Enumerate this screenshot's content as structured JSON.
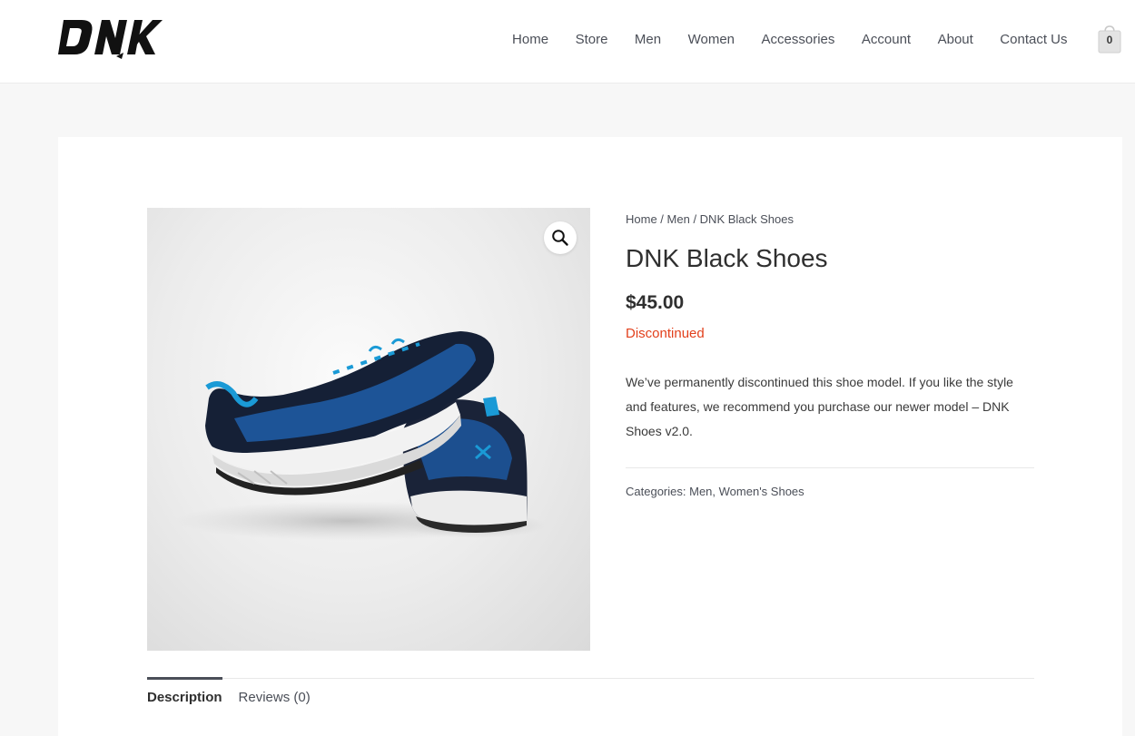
{
  "header": {
    "logo_alt": "DNK",
    "nav": [
      {
        "label": "Home"
      },
      {
        "label": "Store"
      },
      {
        "label": "Men"
      },
      {
        "label": "Women"
      },
      {
        "label": "Accessories"
      },
      {
        "label": "Account"
      },
      {
        "label": "About"
      },
      {
        "label": "Contact Us"
      }
    ],
    "cart": {
      "count": "0",
      "icon": "shopping-bag-icon"
    }
  },
  "product": {
    "breadcrumb": {
      "home": "Home",
      "separator": " / ",
      "category": "Men",
      "current": "DNK Black Shoes"
    },
    "title": "DNK Black Shoes",
    "price": "$45.00",
    "stock_status": "Discontinued",
    "short_description": "We’ve permanently discontinued this shoe model. If you like the style and features, we recommend you purchase our newer model – DNK Shoes v2.0.",
    "categories_label": "Categories:",
    "categories": [
      "Men",
      "Women's Shoes"
    ],
    "category_separator": ", ",
    "zoom_icon": "magnifier-icon",
    "image_colors": {
      "accent": "#1a9ad6",
      "upper": "#1d2a45",
      "sole": "#e8e8e8"
    }
  },
  "tabs": [
    {
      "label": "Description",
      "active": true
    },
    {
      "label": "Reviews (0)",
      "active": false
    }
  ],
  "colors": {
    "stock_status": "#e2401c",
    "page_bg": "#f7f7f7",
    "text": "#3a3a3a"
  }
}
